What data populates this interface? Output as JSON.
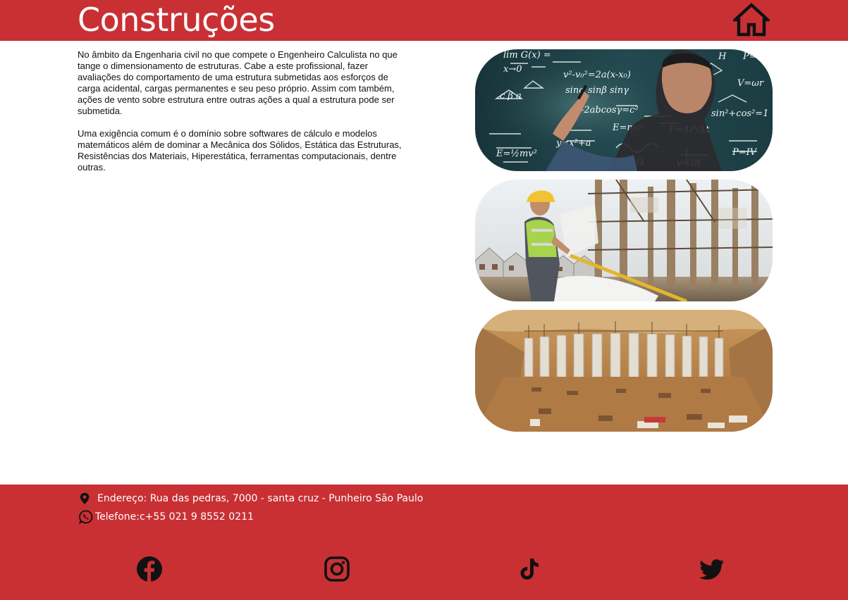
{
  "colors": {
    "brand": "#c93034",
    "text": "#111111",
    "footer_text": "#ffffff"
  },
  "header": {
    "title": "Construções",
    "home_icon": "home-icon"
  },
  "content": {
    "paragraphs": [
      "No âmbito da Engenharia civil no que compete o Engenheiro Calculista no que tange o dimensionamento de estruturas. Cabe a este profissional, fazer avaliações do comportamento de uma estrutura submetidas aos esforços de carga acidental, cargas permanentes e seu peso próprio. Assim com também, ações de vento sobre estrutura entre outras ações a qual a estrutura pode ser submetida.",
      "Uma exigência comum é o domínio sobre softwares de cálculo e modelos matemáticos além de dominar a Mecânica dos Sólidos, Estática das Estruturas, Resistências dos Materiais, Hiperestática, ferramentas computacionais, dentre outras."
    ]
  },
  "gallery": [
    {
      "subject": "engineer writing formulas on glass board"
    },
    {
      "subject": "engineer with hard hat measuring at construction site"
    },
    {
      "subject": "foundation pillars at excavation site"
    }
  ],
  "footer": {
    "address": "Endereço: Rua das pedras, 7000 - santa cruz - Punheiro São Paulo",
    "phone": "Telefone:c+55 021 9 8552 0211",
    "address_icon": "location-pin-icon",
    "phone_icon": "whatsapp-icon",
    "social": [
      "facebook-icon",
      "instagram-icon",
      "tiktok-icon",
      "twitter-icon"
    ]
  }
}
